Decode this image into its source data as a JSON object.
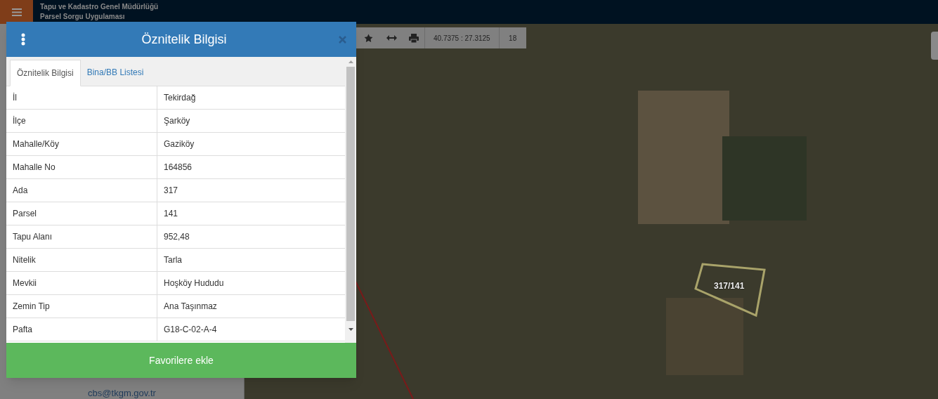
{
  "header": {
    "title": "Tapu ve Kadastro Genel Müdürlüğü",
    "subtitle": "Parsel Sorgu Uygulaması"
  },
  "sidebar": {
    "email": "cbs@tkgm.gov.tr"
  },
  "map_toolbar": {
    "coordinates": "40.7375 : 27.3125",
    "zoom": "18"
  },
  "map": {
    "parcel_label": "317/141"
  },
  "dialog": {
    "title": "Öznitelik Bilgisi",
    "tabs": [
      {
        "label": "Öznitelik Bilgisi",
        "selected": true
      },
      {
        "label": "Bina/BB Listesi",
        "selected": false
      }
    ],
    "rows": [
      {
        "field": "İl",
        "value": "Tekirdağ"
      },
      {
        "field": "İlçe",
        "value": "Şarköy"
      },
      {
        "field": "Mahalle/Köy",
        "value": "Gaziköy"
      },
      {
        "field": "Mahalle No",
        "value": "164856"
      },
      {
        "field": "Ada",
        "value": "317"
      },
      {
        "field": "Parsel",
        "value": "141"
      },
      {
        "field": "Tapu Alanı",
        "value": "952,48"
      },
      {
        "field": "Nitelik",
        "value": "Tarla"
      },
      {
        "field": "Mevkii",
        "value": "Hoşköy Hududu"
      },
      {
        "field": "Zemin Tip",
        "value": "Ana Taşınmaz"
      },
      {
        "field": "Pafta",
        "value": "G18-C-02-A-4"
      }
    ],
    "button": "Favorilere ekle"
  }
}
